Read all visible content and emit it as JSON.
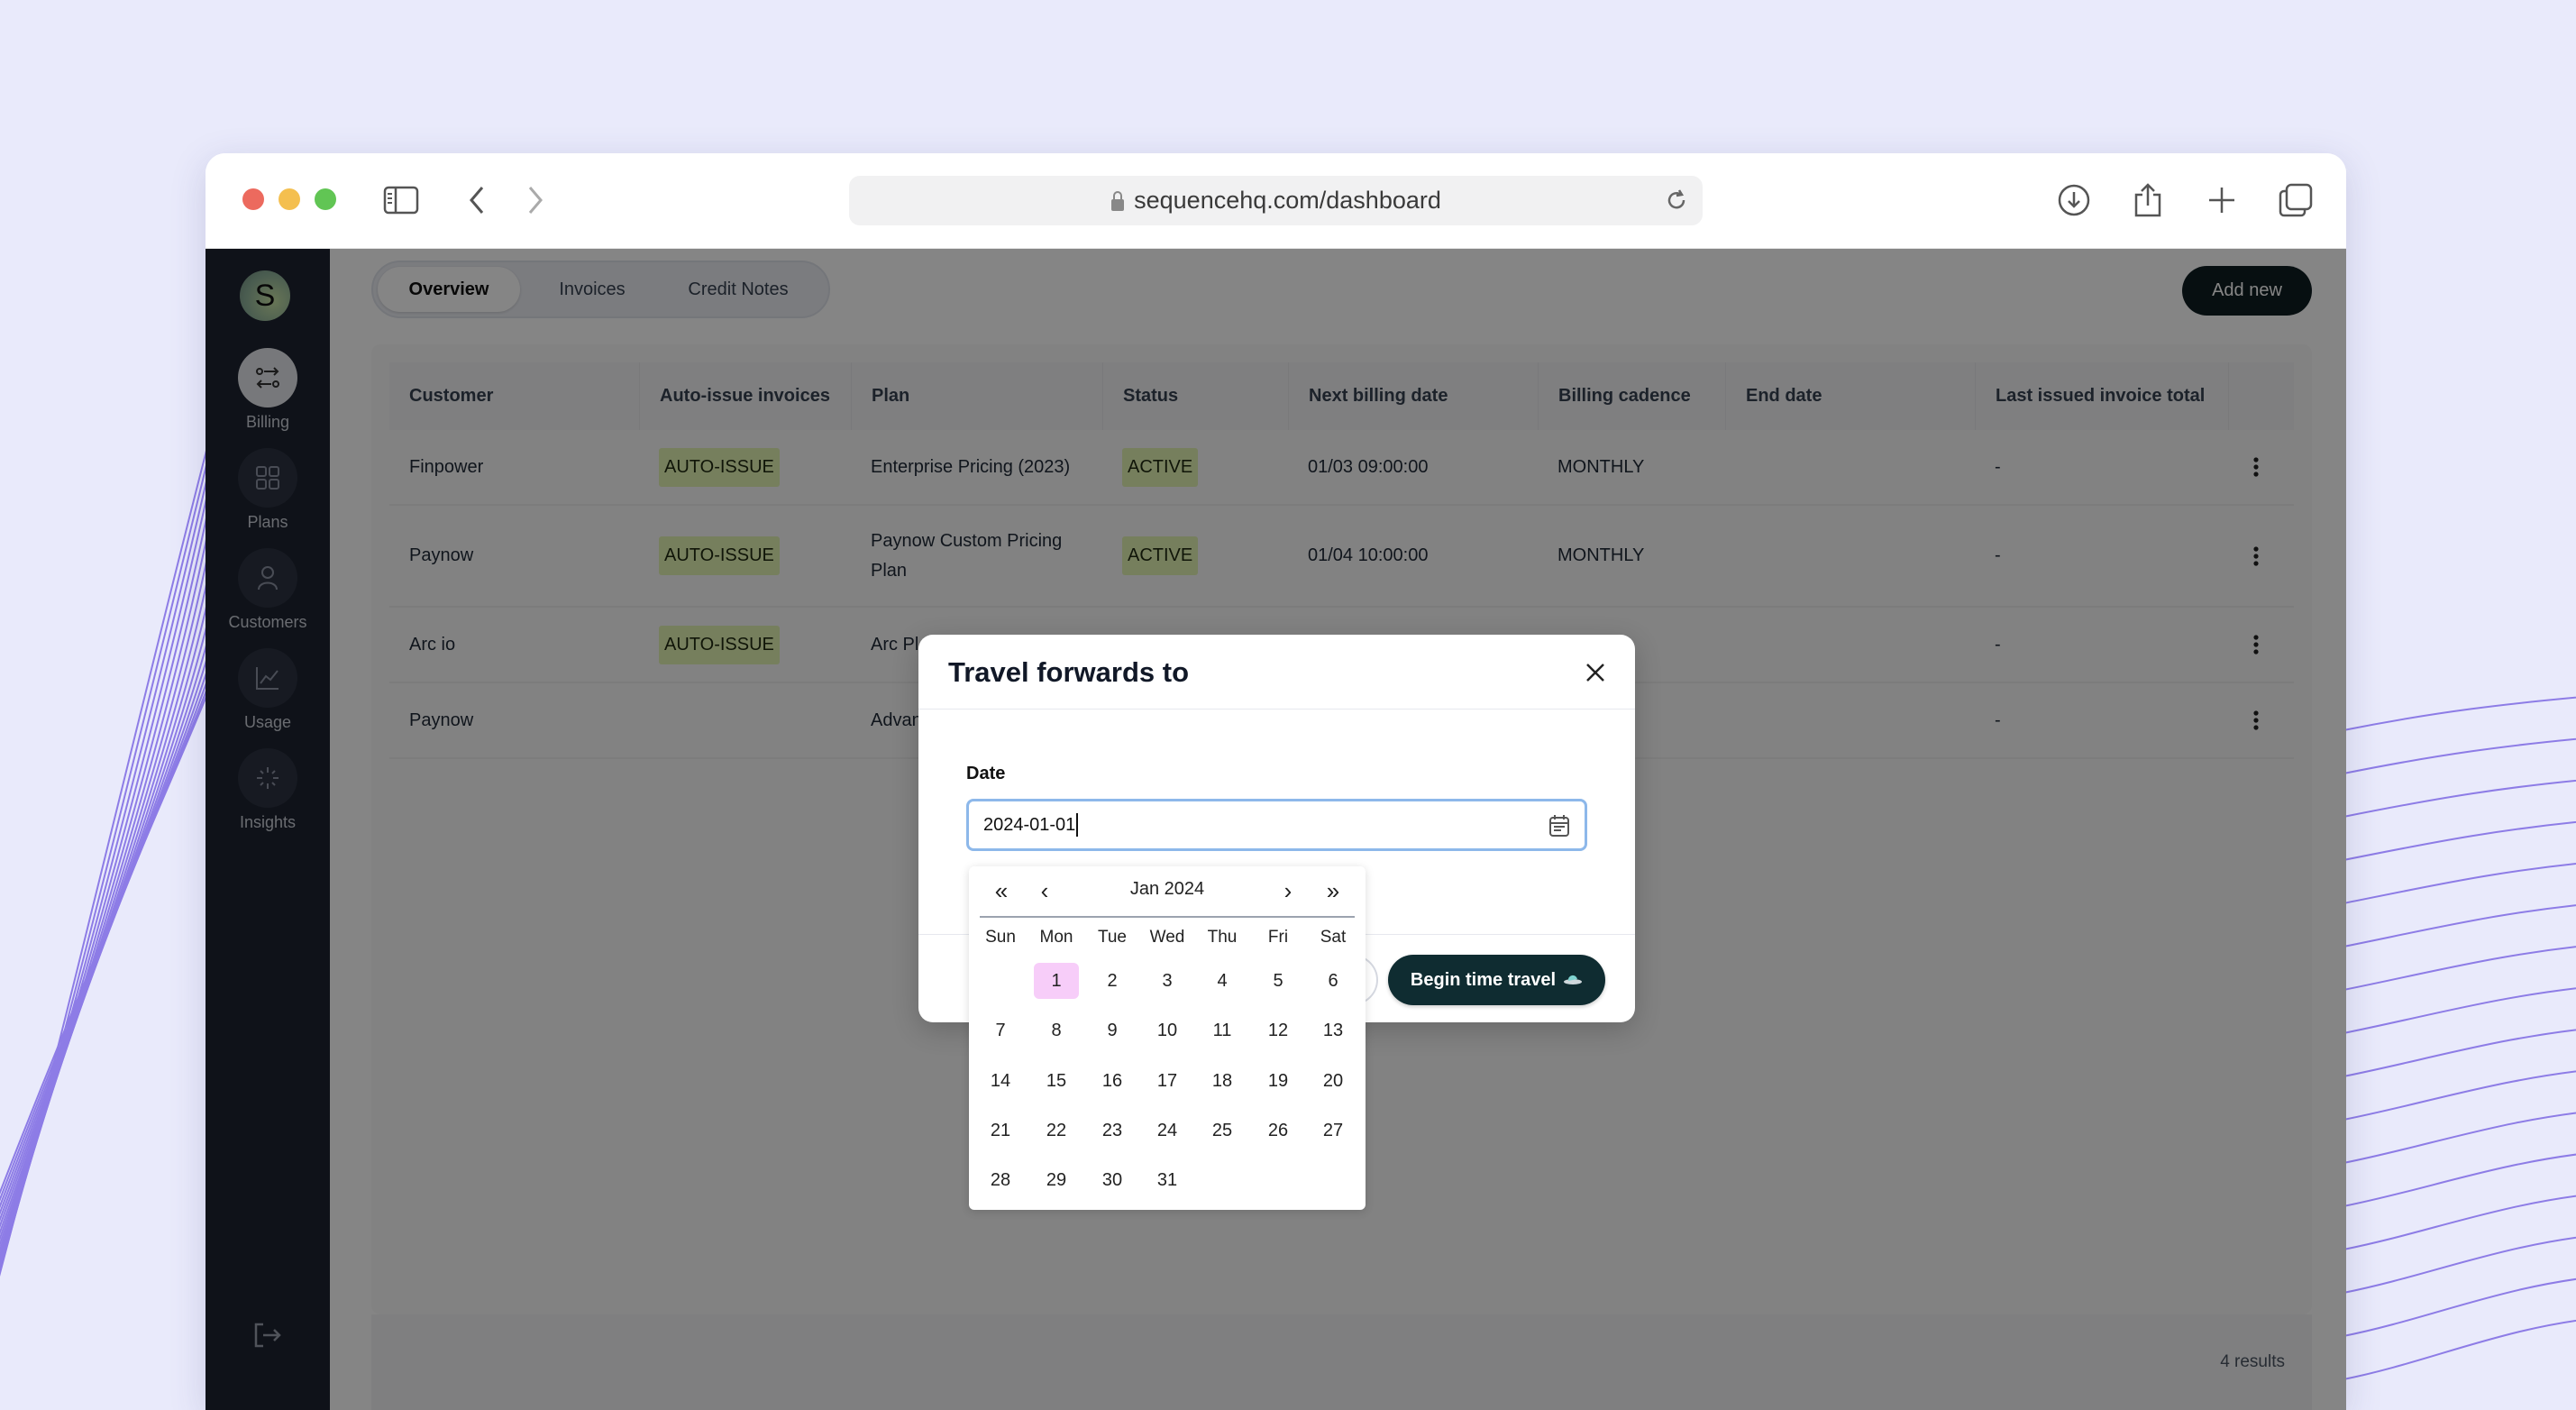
{
  "browser": {
    "url": "sequencehq.com/dashboard",
    "traffic_lights": [
      "#ec6a5e",
      "#f4bf4f",
      "#61c554"
    ],
    "icons": [
      "sidebar-toggle-icon",
      "back-icon",
      "forward-icon",
      "lock-icon",
      "reload-icon",
      "download-icon",
      "share-icon",
      "new-tab-icon",
      "tabs-overview-icon"
    ]
  },
  "sidebar": {
    "avatar_letter": "S",
    "items": [
      {
        "label": "Billing",
        "icon": "billing-icon",
        "active": true
      },
      {
        "label": "Plans",
        "icon": "grid-icon"
      },
      {
        "label": "Customers",
        "icon": "user-icon"
      },
      {
        "label": "Usage",
        "icon": "chart-icon"
      },
      {
        "label": "Insights",
        "icon": "sparkle-icon"
      }
    ],
    "logout_icon": "logout-icon"
  },
  "tabs": [
    {
      "label": "Overview",
      "active": true
    },
    {
      "label": "Invoices"
    },
    {
      "label": "Credit Notes"
    }
  ],
  "add_new_label": "Add new",
  "table": {
    "columns": [
      "Customer",
      "Auto-issue invoices",
      "Plan",
      "Status",
      "Next billing date",
      "Billing cadence",
      "End date",
      "Last issued invoice total"
    ],
    "rows": [
      {
        "customer": "Finpower",
        "auto_issue": "AUTO-ISSUE",
        "plan": "Enterprise Pricing (2023)",
        "status": "ACTIVE",
        "next_billing": "01/03 09:00:00",
        "cadence": "MONTHLY",
        "end_date": "",
        "last_total": "-"
      },
      {
        "customer": "Paynow",
        "auto_issue": "AUTO-ISSUE",
        "plan": "Paynow Custom Pricing Plan",
        "status": "ACTIVE",
        "next_billing": "01/04 10:00:00",
        "cadence": "MONTHLY",
        "end_date": "",
        "last_total": "-"
      },
      {
        "customer": "Arc io",
        "auto_issue": "AUTO-ISSUE",
        "plan": "Arc Pl",
        "status": "",
        "next_billing": "",
        "cadence": "Y",
        "end_date": "",
        "last_total": "-"
      },
      {
        "customer": "Paynow",
        "auto_issue": "",
        "plan": "Advan",
        "status": "",
        "next_billing": "",
        "cadence": "Y",
        "end_date": "",
        "last_total": "-"
      }
    ],
    "results": "4 results"
  },
  "modal": {
    "title": "Travel forwards to",
    "date_label": "Date",
    "date_value": "2024-01-01",
    "begin_label": "Begin time travel",
    "begin_icon": "ufo-icon"
  },
  "calendar": {
    "month": "Jan 2024",
    "nav": {
      "prev_year": "«",
      "prev_month": "‹",
      "next_month": "›",
      "next_year": "»"
    },
    "weekdays": [
      "Sun",
      "Mon",
      "Tue",
      "Wed",
      "Thu",
      "Fri",
      "Sat"
    ],
    "weeks": [
      [
        "",
        "1",
        "2",
        "3",
        "4",
        "5",
        "6"
      ],
      [
        "7",
        "8",
        "9",
        "10",
        "11",
        "12",
        "13"
      ],
      [
        "14",
        "15",
        "16",
        "17",
        "18",
        "19",
        "20"
      ],
      [
        "21",
        "22",
        "23",
        "24",
        "25",
        "26",
        "27"
      ],
      [
        "28",
        "29",
        "30",
        "31",
        "",
        "",
        ""
      ]
    ],
    "selected": "1",
    "selected_color": "#f7cdf9"
  }
}
